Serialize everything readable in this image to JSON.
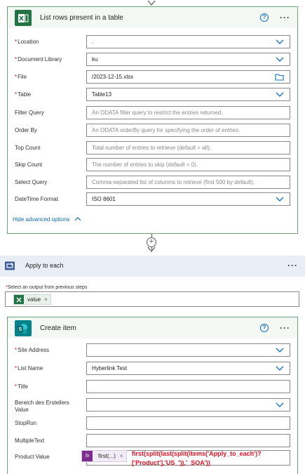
{
  "list_rows": {
    "title": "List rows present in a table",
    "help": "?",
    "more": "···",
    "fields": [
      {
        "label": "Location",
        "required": true,
        "value": "",
        "placeholder": "",
        "control": "dropdown"
      },
      {
        "label": "Document Library",
        "required": true,
        "value": "ku",
        "placeholder": "",
        "control": "dropdown"
      },
      {
        "label": "File",
        "required": true,
        "value": "/2023-12-15.xlsx",
        "placeholder": "",
        "control": "folder"
      },
      {
        "label": "Table",
        "required": true,
        "value": "Table13",
        "placeholder": "",
        "control": "dropdown"
      },
      {
        "label": "Filter Query",
        "required": false,
        "value": "",
        "placeholder": "An ODATA filter query to restrict the entries returned.",
        "control": "text"
      },
      {
        "label": "Order By",
        "required": false,
        "value": "",
        "placeholder": "An ODATA orderBy query for specifying the order of entries.",
        "control": "text"
      },
      {
        "label": "Top Count",
        "required": false,
        "value": "",
        "placeholder": "Total number of entries to retrieve (default = all).",
        "control": "text"
      },
      {
        "label": "Skip Count",
        "required": false,
        "value": "",
        "placeholder": "The number of entries to skip (default = 0).",
        "control": "text"
      },
      {
        "label": "Select Query",
        "required": false,
        "value": "",
        "placeholder": "Comma-separated list of columns to retrieve (first 500 by default).",
        "control": "text"
      },
      {
        "label": "DateTime Format",
        "required": false,
        "value": "ISO 8601",
        "placeholder": "",
        "control": "dropdown"
      }
    ],
    "advanced_link": "Hide advanced options"
  },
  "connector": {
    "plus": "+"
  },
  "apply_each": {
    "title": "Apply to each",
    "more": "···",
    "output_label": "Select an output from previous steps",
    "token_label": "value",
    "token_remove": "×"
  },
  "create_item": {
    "title": "Create item",
    "help": "?",
    "more": "···",
    "fields": [
      {
        "label": "Site Address",
        "required": true,
        "value": "",
        "control": "dropdown"
      },
      {
        "label": "List Name",
        "required": true,
        "value": "Hyberlink Test",
        "control": "dropdown"
      },
      {
        "label": "Title",
        "required": true,
        "value": "",
        "control": "text"
      },
      {
        "label": "Bereich des Erstellers Value",
        "required": false,
        "value": "",
        "control": "dropdown"
      },
      {
        "label": "StopRun",
        "required": false,
        "value": "",
        "control": "text"
      },
      {
        "label": "MultipleText",
        "required": false,
        "value": "",
        "control": "text"
      },
      {
        "label": "Product Value",
        "required": false,
        "value": "",
        "control": "expression"
      }
    ],
    "fx_token_icon": "fx",
    "fx_token_label": "first(...)",
    "fx_token_remove": "×",
    "formula_text": "first(split(last(split(items('Apply_to_each')?['Product'],'US_')),'_SOA'))"
  },
  "colors": {
    "card_border": "#6aa27a",
    "header_bg": "#f3f8f4",
    "excel_green": "#217346",
    "sharepoint_teal": "#038387",
    "link_blue": "#0f6cbd",
    "required_red": "#c50f1f",
    "formula_red": "#e81123",
    "band_bg": "#e9eef6"
  }
}
